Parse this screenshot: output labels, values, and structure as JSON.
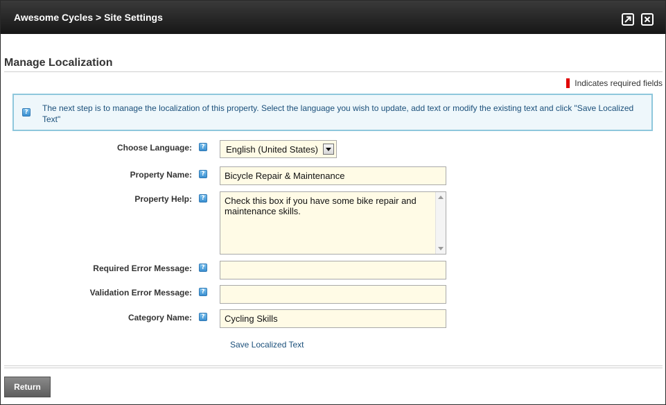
{
  "window": {
    "title": "Awesome Cycles > Site Settings",
    "maximize_icon": "external-arrow-icon",
    "close_icon": "close-icon"
  },
  "section": {
    "title": "Manage Localization",
    "required_legend": "Indicates required fields",
    "required_color": "#e00000"
  },
  "info": {
    "icon": "help-icon",
    "text": "The next step is to manage the localization of this property. Select the language you wish to update, add text or modify the existing text and click \"Save Localized Text\""
  },
  "form": {
    "help_icon_glyph": "?",
    "language": {
      "label": "Choose Language:",
      "value": "English (United States)"
    },
    "property_name": {
      "label": "Property Name:",
      "value": "Bicycle Repair & Maintenance"
    },
    "property_help": {
      "label": "Property Help:",
      "value": "Check this box if you have some bike repair and maintenance skills."
    },
    "required_error": {
      "label": "Required Error Message:",
      "value": ""
    },
    "validation_error": {
      "label": "Validation Error Message:",
      "value": ""
    },
    "category_name": {
      "label": "Category Name:",
      "value": "Cycling Skills"
    },
    "save_label": "Save Localized Text"
  },
  "footer": {
    "return_label": "Return"
  },
  "colors": {
    "titlebar": "#222222",
    "field_background": "#fffbe6",
    "info_border": "#8ec7dc",
    "link": "#1a4f7a"
  }
}
